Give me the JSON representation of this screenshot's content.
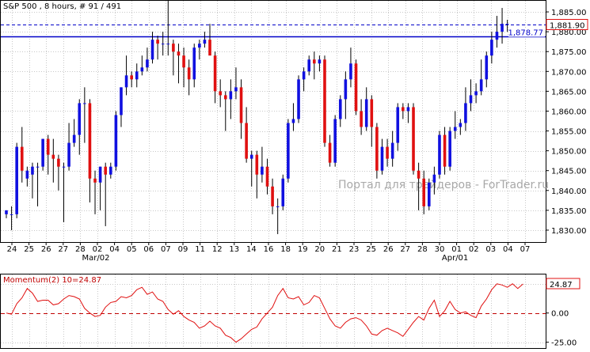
{
  "header": {
    "title": "S&P 500 , 8 hours, # 91 / 491"
  },
  "watermark": "Портал для трейдеров - ForTrader.ru",
  "colors": {
    "up": "#1010e0",
    "down": "#e01010",
    "grid": "#c8c8c8",
    "hline": "#0000c8",
    "bid_dash": "#0000c8",
    "momentum": "#e01010",
    "momentum_zero": "#c00000"
  },
  "chart_data": [
    {
      "type": "candlestick",
      "title": "S&P 500 , 8 hours, # 91 / 491",
      "ylim": [
        1827,
        1888
      ],
      "y_ticks": [
        "1,830.00",
        "1,835.00",
        "1,840.00",
        "1,845.00",
        "1,850.00",
        "1,855.00",
        "1,860.00",
        "1,865.00",
        "1,870.00",
        "1,875.00",
        "1,880.00",
        "1,885.00"
      ],
      "x_day_labels": [
        "24",
        "25",
        "26",
        "27",
        "28",
        "02",
        "04",
        "05",
        "06",
        "07",
        "09",
        "11",
        "12",
        "13",
        "14",
        "16",
        "18",
        "19",
        "20",
        "21",
        "23",
        "25",
        "26",
        "27",
        "28",
        "30",
        "01",
        "02",
        "03",
        "04",
        "07"
      ],
      "x_month_labels": [
        "Mar/02",
        "Apr/01"
      ],
      "price_lines": [
        {
          "label": "1,878.77",
          "value": 1878.77,
          "style": "solid"
        },
        {
          "label": "1,881.90",
          "value": 1881.9,
          "style": "dashed"
        }
      ],
      "candles": [
        {
          "o": 1834.0,
          "h": 1835.0,
          "l": 1833.0,
          "c": 1835.0
        },
        {
          "o": 1834.0,
          "h": 1836.0,
          "l": 1830.0,
          "c": 1834.0
        },
        {
          "o": 1834.0,
          "h": 1852.0,
          "l": 1833.0,
          "c": 1851.0
        },
        {
          "o": 1851.0,
          "h": 1856.0,
          "l": 1842.0,
          "c": 1845.0
        },
        {
          "o": 1843.0,
          "h": 1846.0,
          "l": 1841.0,
          "c": 1845.0
        },
        {
          "o": 1844.0,
          "h": 1847.0,
          "l": 1838.0,
          "c": 1846.0
        },
        {
          "o": 1846.0,
          "h": 1847.0,
          "l": 1836.0,
          "c": 1846.0
        },
        {
          "o": 1846.0,
          "h": 1853.0,
          "l": 1845.0,
          "c": 1853.0
        },
        {
          "o": 1853.0,
          "h": 1854.0,
          "l": 1844.0,
          "c": 1849.0
        },
        {
          "o": 1849.0,
          "h": 1853.0,
          "l": 1842.0,
          "c": 1848.0
        },
        {
          "o": 1848.0,
          "h": 1849.0,
          "l": 1840.0,
          "c": 1846.0
        },
        {
          "o": 1846.0,
          "h": 1847.0,
          "l": 1832.0,
          "c": 1846.0
        },
        {
          "o": 1846.0,
          "h": 1857.0,
          "l": 1845.0,
          "c": 1852.0
        },
        {
          "o": 1852.0,
          "h": 1858.0,
          "l": 1851.0,
          "c": 1854.0
        },
        {
          "o": 1854.0,
          "h": 1863.0,
          "l": 1849.0,
          "c": 1862.0
        },
        {
          "o": 1862.0,
          "h": 1866.0,
          "l": 1852.0,
          "c": 1862.0
        },
        {
          "o": 1862.0,
          "h": 1863.0,
          "l": 1837.0,
          "c": 1843.0
        },
        {
          "o": 1843.0,
          "h": 1845.0,
          "l": 1834.0,
          "c": 1842.0
        },
        {
          "o": 1842.0,
          "h": 1846.0,
          "l": 1835.0,
          "c": 1846.0
        },
        {
          "o": 1846.0,
          "h": 1847.0,
          "l": 1831.0,
          "c": 1844.0
        },
        {
          "o": 1844.0,
          "h": 1847.0,
          "l": 1843.0,
          "c": 1846.0
        },
        {
          "o": 1846.0,
          "h": 1860.0,
          "l": 1845.0,
          "c": 1859.0
        },
        {
          "o": 1859.0,
          "h": 1866.0,
          "l": 1856.0,
          "c": 1866.0
        },
        {
          "o": 1866.0,
          "h": 1874.0,
          "l": 1864.0,
          "c": 1869.0
        },
        {
          "o": 1869.0,
          "h": 1870.0,
          "l": 1866.0,
          "c": 1868.0
        },
        {
          "o": 1868.0,
          "h": 1872.0,
          "l": 1866.0,
          "c": 1870.0
        },
        {
          "o": 1870.0,
          "h": 1874.0,
          "l": 1869.0,
          "c": 1871.0
        },
        {
          "o": 1871.0,
          "h": 1876.0,
          "l": 1870.0,
          "c": 1873.0
        },
        {
          "o": 1873.0,
          "h": 1880.0,
          "l": 1872.0,
          "c": 1878.0
        },
        {
          "o": 1878.0,
          "h": 1879.0,
          "l": 1873.0,
          "c": 1877.0
        },
        {
          "o": 1877.0,
          "h": 1880.0,
          "l": 1874.0,
          "c": 1877.0
        },
        {
          "o": 1877.0,
          "h": 1888.0,
          "l": 1874.0,
          "c": 1877.0
        },
        {
          "o": 1877.0,
          "h": 1878.0,
          "l": 1869.0,
          "c": 1875.0
        },
        {
          "o": 1875.0,
          "h": 1877.0,
          "l": 1867.0,
          "c": 1874.0
        },
        {
          "o": 1874.0,
          "h": 1876.0,
          "l": 1866.0,
          "c": 1871.0
        },
        {
          "o": 1871.0,
          "h": 1873.0,
          "l": 1864.0,
          "c": 1868.0
        },
        {
          "o": 1868.0,
          "h": 1877.0,
          "l": 1866.0,
          "c": 1876.0
        },
        {
          "o": 1876.0,
          "h": 1878.0,
          "l": 1873.0,
          "c": 1877.0
        },
        {
          "o": 1877.0,
          "h": 1880.0,
          "l": 1876.0,
          "c": 1878.0
        },
        {
          "o": 1878.0,
          "h": 1882.0,
          "l": 1876.0,
          "c": 1874.0
        },
        {
          "o": 1874.0,
          "h": 1875.0,
          "l": 1862.0,
          "c": 1865.0
        },
        {
          "o": 1865.0,
          "h": 1868.0,
          "l": 1861.0,
          "c": 1864.0
        },
        {
          "o": 1864.0,
          "h": 1865.0,
          "l": 1855.0,
          "c": 1863.0
        },
        {
          "o": 1863.0,
          "h": 1868.0,
          "l": 1858.0,
          "c": 1865.0
        },
        {
          "o": 1865.0,
          "h": 1871.0,
          "l": 1863.0,
          "c": 1866.0
        },
        {
          "o": 1866.0,
          "h": 1868.0,
          "l": 1853.0,
          "c": 1857.0
        },
        {
          "o": 1857.0,
          "h": 1861.0,
          "l": 1847.0,
          "c": 1848.0
        },
        {
          "o": 1848.0,
          "h": 1850.0,
          "l": 1841.0,
          "c": 1849.0
        },
        {
          "o": 1849.0,
          "h": 1850.0,
          "l": 1838.0,
          "c": 1844.0
        },
        {
          "o": 1844.0,
          "h": 1851.0,
          "l": 1842.0,
          "c": 1846.0
        },
        {
          "o": 1846.0,
          "h": 1848.0,
          "l": 1839.0,
          "c": 1841.0
        },
        {
          "o": 1841.0,
          "h": 1843.0,
          "l": 1834.0,
          "c": 1836.0
        },
        {
          "o": 1836.0,
          "h": 1838.0,
          "l": 1829.0,
          "c": 1836.0
        },
        {
          "o": 1836.0,
          "h": 1844.0,
          "l": 1835.0,
          "c": 1843.0
        },
        {
          "o": 1843.0,
          "h": 1858.0,
          "l": 1842.0,
          "c": 1857.0
        },
        {
          "o": 1857.0,
          "h": 1862.0,
          "l": 1855.0,
          "c": 1858.0
        },
        {
          "o": 1858.0,
          "h": 1869.0,
          "l": 1857.0,
          "c": 1868.0
        },
        {
          "o": 1868.0,
          "h": 1871.0,
          "l": 1865.0,
          "c": 1870.0
        },
        {
          "o": 1870.0,
          "h": 1874.0,
          "l": 1869.0,
          "c": 1873.0
        },
        {
          "o": 1873.0,
          "h": 1875.0,
          "l": 1868.0,
          "c": 1872.0
        },
        {
          "o": 1872.0,
          "h": 1874.0,
          "l": 1870.0,
          "c": 1873.0
        },
        {
          "o": 1873.0,
          "h": 1874.0,
          "l": 1851.0,
          "c": 1852.0
        },
        {
          "o": 1852.0,
          "h": 1854.0,
          "l": 1846.0,
          "c": 1847.0
        },
        {
          "o": 1847.0,
          "h": 1859.0,
          "l": 1846.0,
          "c": 1858.0
        },
        {
          "o": 1858.0,
          "h": 1864.0,
          "l": 1856.0,
          "c": 1863.0
        },
        {
          "o": 1863.0,
          "h": 1870.0,
          "l": 1858.0,
          "c": 1868.0
        },
        {
          "o": 1868.0,
          "h": 1876.0,
          "l": 1866.0,
          "c": 1872.0
        },
        {
          "o": 1872.0,
          "h": 1873.0,
          "l": 1859.0,
          "c": 1860.0
        },
        {
          "o": 1860.0,
          "h": 1863.0,
          "l": 1854.0,
          "c": 1856.0
        },
        {
          "o": 1856.0,
          "h": 1866.0,
          "l": 1855.0,
          "c": 1863.0
        },
        {
          "o": 1863.0,
          "h": 1864.0,
          "l": 1851.0,
          "c": 1856.0
        },
        {
          "o": 1856.0,
          "h": 1857.0,
          "l": 1843.0,
          "c": 1845.0
        },
        {
          "o": 1845.0,
          "h": 1853.0,
          "l": 1844.0,
          "c": 1851.0
        },
        {
          "o": 1851.0,
          "h": 1853.0,
          "l": 1846.0,
          "c": 1848.0
        },
        {
          "o": 1848.0,
          "h": 1855.0,
          "l": 1846.0,
          "c": 1852.0
        },
        {
          "o": 1852.0,
          "h": 1862.0,
          "l": 1850.0,
          "c": 1861.0
        },
        {
          "o": 1861.0,
          "h": 1862.0,
          "l": 1858.0,
          "c": 1860.0
        },
        {
          "o": 1860.0,
          "h": 1862.0,
          "l": 1857.0,
          "c": 1861.0
        },
        {
          "o": 1861.0,
          "h": 1862.0,
          "l": 1844.0,
          "c": 1845.0
        },
        {
          "o": 1845.0,
          "h": 1847.0,
          "l": 1835.0,
          "c": 1843.0
        },
        {
          "o": 1843.0,
          "h": 1845.0,
          "l": 1834.0,
          "c": 1836.0
        },
        {
          "o": 1836.0,
          "h": 1843.0,
          "l": 1835.0,
          "c": 1842.0
        },
        {
          "o": 1842.0,
          "h": 1846.0,
          "l": 1839.0,
          "c": 1844.0
        },
        {
          "o": 1844.0,
          "h": 1855.0,
          "l": 1843.0,
          "c": 1854.0
        },
        {
          "o": 1854.0,
          "h": 1856.0,
          "l": 1844.0,
          "c": 1846.0
        },
        {
          "o": 1846.0,
          "h": 1856.0,
          "l": 1845.0,
          "c": 1855.0
        },
        {
          "o": 1855.0,
          "h": 1860.0,
          "l": 1853.0,
          "c": 1856.0
        },
        {
          "o": 1856.0,
          "h": 1858.0,
          "l": 1854.0,
          "c": 1857.0
        },
        {
          "o": 1857.0,
          "h": 1866.0,
          "l": 1855.0,
          "c": 1862.0
        },
        {
          "o": 1862.0,
          "h": 1868.0,
          "l": 1860.0,
          "c": 1864.0
        },
        {
          "o": 1864.0,
          "h": 1867.0,
          "l": 1862.0,
          "c": 1865.0
        },
        {
          "o": 1865.0,
          "h": 1873.0,
          "l": 1864.0,
          "c": 1868.0
        },
        {
          "o": 1868.0,
          "h": 1875.0,
          "l": 1866.0,
          "c": 1874.0
        },
        {
          "o": 1874.0,
          "h": 1880.0,
          "l": 1872.0,
          "c": 1878.0
        },
        {
          "o": 1878.0,
          "h": 1884.0,
          "l": 1876.0,
          "c": 1880.0
        },
        {
          "o": 1880.0,
          "h": 1886.0,
          "l": 1877.0,
          "c": 1882.0
        },
        {
          "o": 1882.0,
          "h": 1883.0,
          "l": 1880.0,
          "c": 1882.0
        }
      ]
    },
    {
      "type": "line",
      "title": "Momentum(2) 10=24.87",
      "ylim": [
        -30,
        33
      ],
      "y_ticks": [
        "25.00",
        "0.00",
        "-25.00"
      ],
      "value_label": "24.87",
      "current_value": 24.87,
      "zero_line": 0,
      "values": [
        0,
        -1,
        8,
        13,
        21,
        17,
        10,
        11,
        11,
        7,
        8,
        12,
        15,
        14,
        12,
        4,
        0,
        -3,
        -2,
        5,
        9,
        10,
        14,
        13,
        15,
        20,
        22,
        16,
        18,
        12,
        10,
        3,
        -1,
        2,
        -3,
        -6,
        -8,
        -13,
        -11,
        -7,
        -11,
        -13,
        -19,
        -21,
        -25,
        -22,
        -18,
        -14,
        -12,
        -5,
        0,
        5,
        15,
        21,
        13,
        12,
        14,
        7,
        9,
        15,
        13,
        4,
        -5,
        -11,
        -13,
        -8,
        -5,
        -4,
        -6,
        -11,
        -18,
        -19,
        -15,
        -13,
        -15,
        -17,
        -20,
        -14,
        -8,
        -3,
        -6,
        4,
        11,
        -3,
        2,
        10,
        3,
        0,
        1,
        -2,
        -4,
        6,
        12,
        20,
        25,
        24,
        22,
        25,
        21,
        24.87
      ]
    }
  ]
}
